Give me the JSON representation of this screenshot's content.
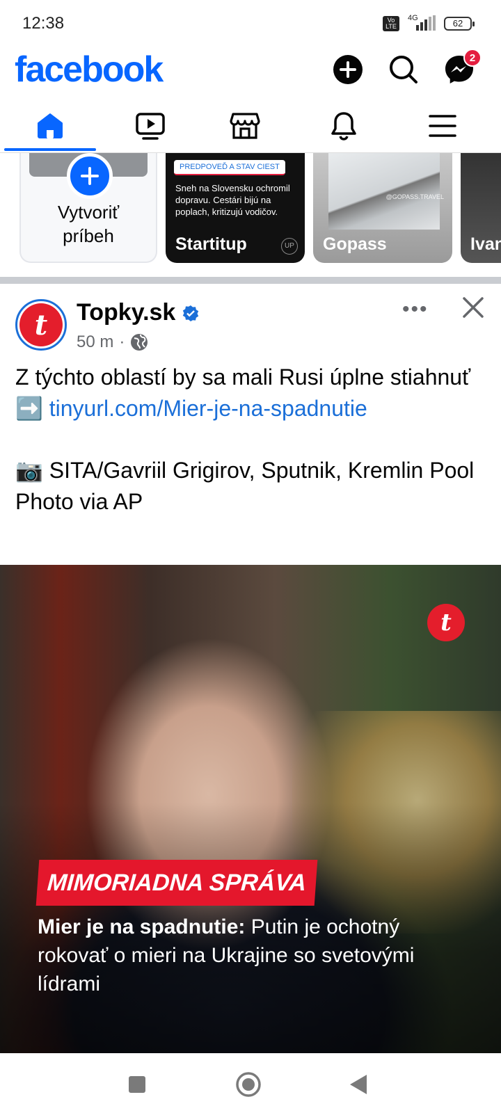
{
  "status_bar": {
    "time": "12:38",
    "volte": "Vo LTE",
    "network": "4G",
    "battery": "62"
  },
  "header": {
    "logo": "facebook",
    "icons": [
      "plus-icon",
      "search-icon",
      "messenger-icon"
    ],
    "messenger_badge": "2"
  },
  "tabs": [
    {
      "name": "home",
      "icon": "home-icon",
      "active": true
    },
    {
      "name": "video",
      "icon": "video-icon",
      "active": false
    },
    {
      "name": "marketplace",
      "icon": "marketplace-icon",
      "active": false
    },
    {
      "name": "notifications",
      "icon": "bell-icon",
      "active": false
    },
    {
      "name": "menu",
      "icon": "menu-icon",
      "active": false
    }
  ],
  "stories": {
    "create": {
      "label_line1": "Vytvoriť",
      "label_line2": "príbeh"
    },
    "items": [
      {
        "name": "Startitup",
        "chip": "PREDPOVEĎ A STAV CIEST",
        "text": "Sneh na Slovensku ochromil dopravu. Cestári bijú na poplach, kritizujú vodičov.",
        "corner_mark": "UP"
      },
      {
        "name": "Gopass",
        "tag": "@GOPASS.TRAVEL"
      },
      {
        "name": "Ivan"
      }
    ]
  },
  "post": {
    "page_name": "Topky.sk",
    "avatar_letter": "t",
    "time": "50 m",
    "separator": "·",
    "text_line1": "Z týchto oblastí by sa mali Rusi úplne stiahnuť ➡️ ",
    "link": "tinyurl.com/Mier-je-na-spadnutie",
    "credit": "📷 SITA/Gavriil Grigirov, Sputnik, Kremlin Pool Photo via AP",
    "image": {
      "brand_mark": "t",
      "breaking_label": "MIMORIADNA SPRÁVA",
      "headline_bold": "Mier je na spadnutie:",
      "headline_rest": " Putin je ochotný rokovať o mieri na Ukrajine so svetovými lídrami"
    }
  },
  "colors": {
    "facebook_blue": "#0866ff",
    "link_blue": "#1b6fd8",
    "badge_red": "#e41e3f",
    "topky_red": "#e41e2c",
    "secondary_text": "#65676b"
  }
}
